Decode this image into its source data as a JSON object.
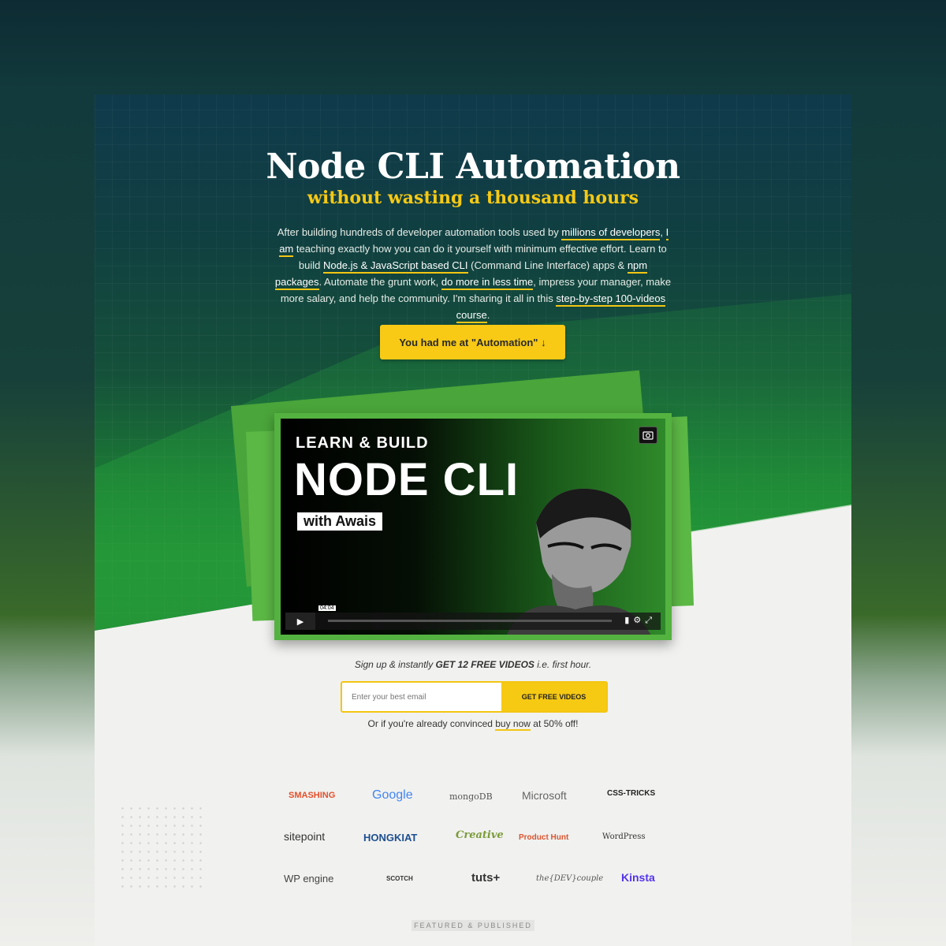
{
  "hero": {
    "title": "Node CLI Automation",
    "subtitle": "without wasting a thousand hours",
    "intro": [
      {
        "t": "After building hundreds of developer automation tools used by "
      },
      {
        "t": "millions of developers",
        "u": true
      },
      {
        "t": ", "
      },
      {
        "t": "I am",
        "u": true
      },
      {
        "t": " teaching exactly how you can do it yourself with minimum effective effort. Learn to build "
      },
      {
        "t": "Node.js & JavaScript based CLI",
        "u": true
      },
      {
        "t": " (Command Line Interface) apps & "
      },
      {
        "t": "npm packages",
        "u": true
      },
      {
        "t": ". Automate the grunt work, "
      },
      {
        "t": "do more in less time",
        "u": true
      },
      {
        "t": ", impress your manager, make more salary, and help the community. I'm sharing it all in this "
      },
      {
        "t": "step-by-step 100-videos course",
        "u": true
      },
      {
        "t": "."
      }
    ],
    "cta_label": "You had me at \"Automation\" ↓"
  },
  "video": {
    "learn": "LEARN & BUILD",
    "node": "NODE CLI",
    "with": "with Awais",
    "time": "04:04",
    "play_icon": "play-icon",
    "camera_icon": "camera-icon"
  },
  "signup": {
    "pre": "Sign up & instantly ",
    "bold": "GET 12 FREE VIDEOS",
    "post": " i.e. first hour.",
    "email_placeholder": "Enter your best email",
    "button": "GET FREE VIDEOS",
    "buy_pre": "Or if you're already convinced ",
    "buy_link": "buy now",
    "buy_post": " at 50% off!"
  },
  "logos": [
    "SMASHING",
    "Google",
    "mongoDB",
    "Microsoft",
    "CSS-TRICKS",
    "sitepoint",
    "HONGKIAT",
    "Creative",
    "Product Hunt",
    "WordPress",
    "WP engine",
    "SCOTCH",
    "tuts+",
    "the{DEV}couple",
    "Kinsta"
  ],
  "featured": "FEATURED & PUBLISHED",
  "colors": {
    "accent": "#f6c913",
    "green": "#228c35",
    "dark": "#0f3a4c"
  }
}
